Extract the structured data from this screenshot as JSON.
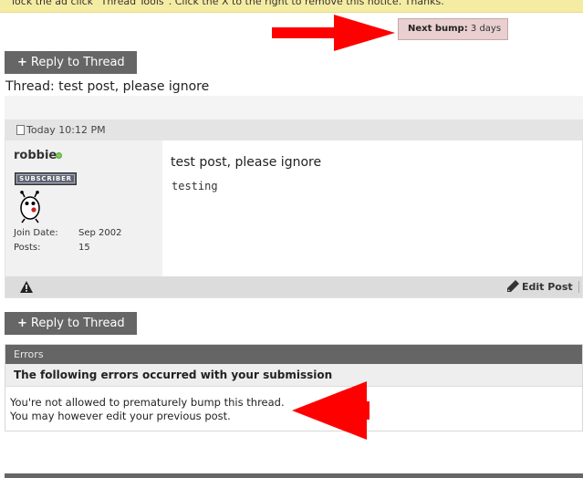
{
  "notice": {
    "text": "lock the ad click \"Thread Tools\". Click the X to the right to remove this notice. Thanks."
  },
  "bump": {
    "label": "Next bump:",
    "value": "3 days"
  },
  "reply_button": {
    "label": "Reply to Thread",
    "plus": "+"
  },
  "thread": {
    "title": "Thread: test post, please ignore"
  },
  "post": {
    "timestamp": "Today 10:12 PM",
    "username": "robbie",
    "rank_badge": "SUBSCRIBER",
    "join_date_label": "Join Date:",
    "join_date_value": "Sep 2002",
    "posts_label": "Posts:",
    "posts_value": "15",
    "title": "test post, please ignore",
    "body": "testing",
    "edit_label": "Edit Post"
  },
  "errors": {
    "header": "Errors",
    "subheader": "The following errors occurred with your submission",
    "lines": [
      "You're not allowed to prematurely bump this thread.",
      "You may however edit your previous post."
    ]
  },
  "colors": {
    "arrow": "#ff0000",
    "button": "#666666",
    "bump_bg": "#e9cfcf",
    "notice_bg": "#f5eca3",
    "online": "#7ccf5a"
  },
  "icons": [
    "document-icon",
    "online-status-icon",
    "avatar-icon",
    "warning-icon",
    "pencil-icon"
  ]
}
